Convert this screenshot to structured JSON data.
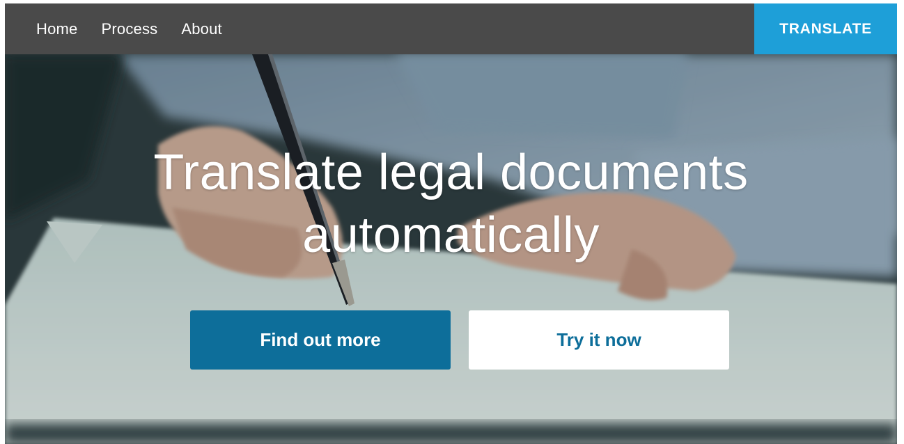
{
  "nav": {
    "links": [
      "Home",
      "Process",
      "About"
    ],
    "cta_label": "TRANSLATE"
  },
  "hero": {
    "title_line1": "Translate legal documents",
    "title_line2": "automatically",
    "primary_button": "Find out more",
    "secondary_button": "Try it now"
  },
  "colors": {
    "navbar_bg": "#4a4a4a",
    "accent": "#1e9fd8",
    "primary_button": "#0d6e9a",
    "secondary_button_text": "#0d6e9a"
  },
  "background_image": "photo-of-hands-signing-document-with-pen"
}
